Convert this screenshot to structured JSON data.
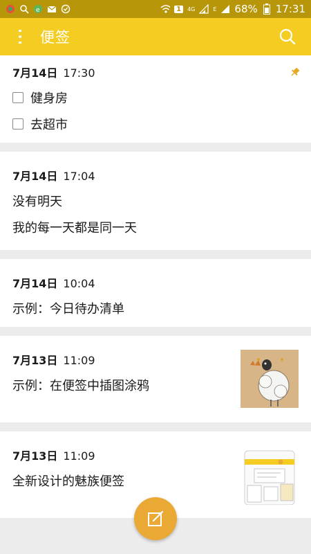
{
  "status_bar": {
    "battery": "68%",
    "time": "17:31",
    "network": "4G",
    "sim": "1",
    "e_label": "E"
  },
  "app_bar": {
    "title": "便签"
  },
  "notes": [
    {
      "date": "7月14日",
      "time": "17:30",
      "pinned": true,
      "checklist": [
        {
          "text": "健身房",
          "checked": false
        },
        {
          "text": "去超市",
          "checked": false
        }
      ]
    },
    {
      "date": "7月14日",
      "time": "17:04",
      "lines": [
        "没有明天",
        "我的每一天都是同一天"
      ]
    },
    {
      "date": "7月14日",
      "time": "10:04",
      "lines": [
        "示例：今日待办清单"
      ]
    },
    {
      "date": "7月13日",
      "time": "11:09",
      "lines": [
        "示例：在便签中插图涂鸦"
      ],
      "thumbnail": "sheep-doodle"
    },
    {
      "date": "7月13日",
      "time": "11:09",
      "lines": [
        "全新设计的魅族便签"
      ],
      "thumbnail": "app-screenshot"
    }
  ],
  "colors": {
    "accent": "#f5cd22",
    "status_bar": "#b8960a",
    "fab": "#e9a934",
    "pin": "#e3a820"
  }
}
